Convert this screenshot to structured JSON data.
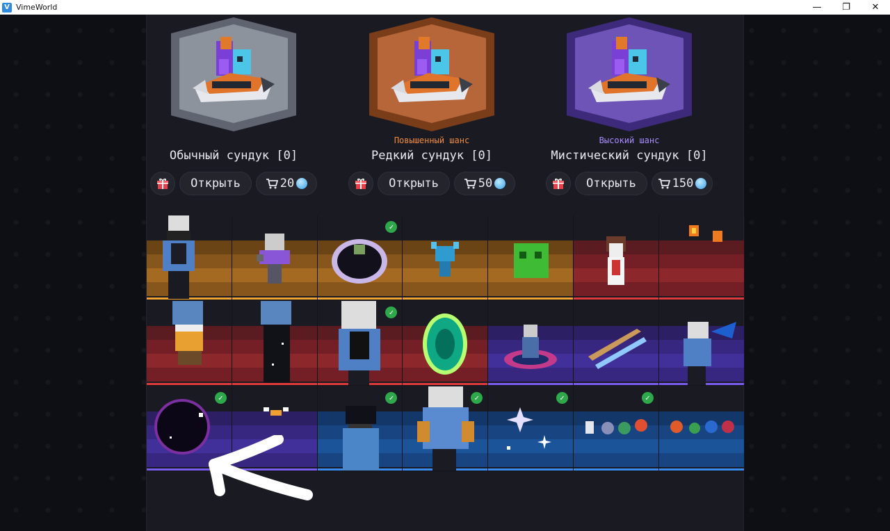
{
  "window": {
    "title": "VimeWorld",
    "controls": [
      "minimize",
      "restore",
      "close"
    ]
  },
  "chests": [
    {
      "name": "Обычный сундук [0]",
      "chance_label": "",
      "chance_color": "",
      "frame_color": "#5f6470",
      "inner_color": "#8c939d",
      "open_label": "Открыть",
      "price": "20"
    },
    {
      "name": "Редкий сундук [0]",
      "chance_label": "Повышенный шанс",
      "chance_color": "#f08a3c",
      "frame_color": "#7a3d1a",
      "inner_color": "#b7663a",
      "open_label": "Открыть",
      "price": "50"
    },
    {
      "name": "Мистический сундук [0]",
      "chance_label": "Высокий шанс",
      "chance_color": "#a98bff",
      "frame_color": "#3d2a7a",
      "inner_color": "#6f54b8",
      "open_label": "Открыть",
      "price": "150"
    }
  ],
  "rarity_colors": {
    "orange": {
      "a": "#6b4416",
      "b": "#87561c",
      "c": "#a46a22",
      "stripe": "#f0a32e"
    },
    "red": {
      "a": "#5a1c20",
      "b": "#731f25",
      "c": "#8c272c",
      "stripe": "#e23a3a"
    },
    "purple": {
      "a": "#2c1f63",
      "b": "#372780",
      "c": "#42309a",
      "stripe": "#7b5cf0"
    },
    "blue": {
      "a": "#14376a",
      "b": "#184582",
      "c": "#1c549a",
      "stripe": "#3a8cf0"
    }
  },
  "items": [
    [
      {
        "icon": "cloak-skin-icon",
        "rarity": "orange",
        "owned": false
      },
      {
        "icon": "robot-pet-icon",
        "rarity": "orange",
        "owned": false
      },
      {
        "icon": "portal-ring-icon",
        "rarity": "orange",
        "owned": true
      },
      {
        "icon": "blue-creature-pet-icon",
        "rarity": "orange",
        "owned": false
      },
      {
        "icon": "green-slime-icon",
        "rarity": "orange",
        "owned": false
      },
      {
        "icon": "skeleton-pet-icon",
        "rarity": "red",
        "owned": false
      },
      {
        "icon": "fire-particles-icon",
        "rarity": "red",
        "owned": false
      }
    ],
    [
      {
        "icon": "fire-boots-icon",
        "rarity": "red",
        "owned": false
      },
      {
        "icon": "starry-pants-icon",
        "rarity": "red",
        "owned": false
      },
      {
        "icon": "starry-outfit-icon",
        "rarity": "red",
        "owned": true
      },
      {
        "icon": "green-portal-icon",
        "rarity": "red",
        "owned": false
      },
      {
        "icon": "galaxy-ring-icon",
        "rarity": "purple",
        "owned": false
      },
      {
        "icon": "twin-blades-icon",
        "rarity": "purple",
        "owned": false
      },
      {
        "icon": "blue-wings-icon",
        "rarity": "purple",
        "owned": false
      }
    ],
    [
      {
        "icon": "black-hole-icon",
        "rarity": "purple",
        "owned": true
      },
      {
        "icon": "orange-eyes-icon",
        "rarity": "purple",
        "owned": false
      },
      {
        "icon": "space-helmet-icon",
        "rarity": "blue",
        "owned": true
      },
      {
        "icon": "golden-armor-icon",
        "rarity": "blue",
        "owned": true
      },
      {
        "icon": "sparkle-particles-icon",
        "rarity": "blue",
        "owned": true
      },
      {
        "icon": "rocket-planets-icon",
        "rarity": "blue",
        "owned": true
      },
      {
        "icon": "planets-trail-icon",
        "rarity": "blue",
        "owned": false
      }
    ]
  ]
}
